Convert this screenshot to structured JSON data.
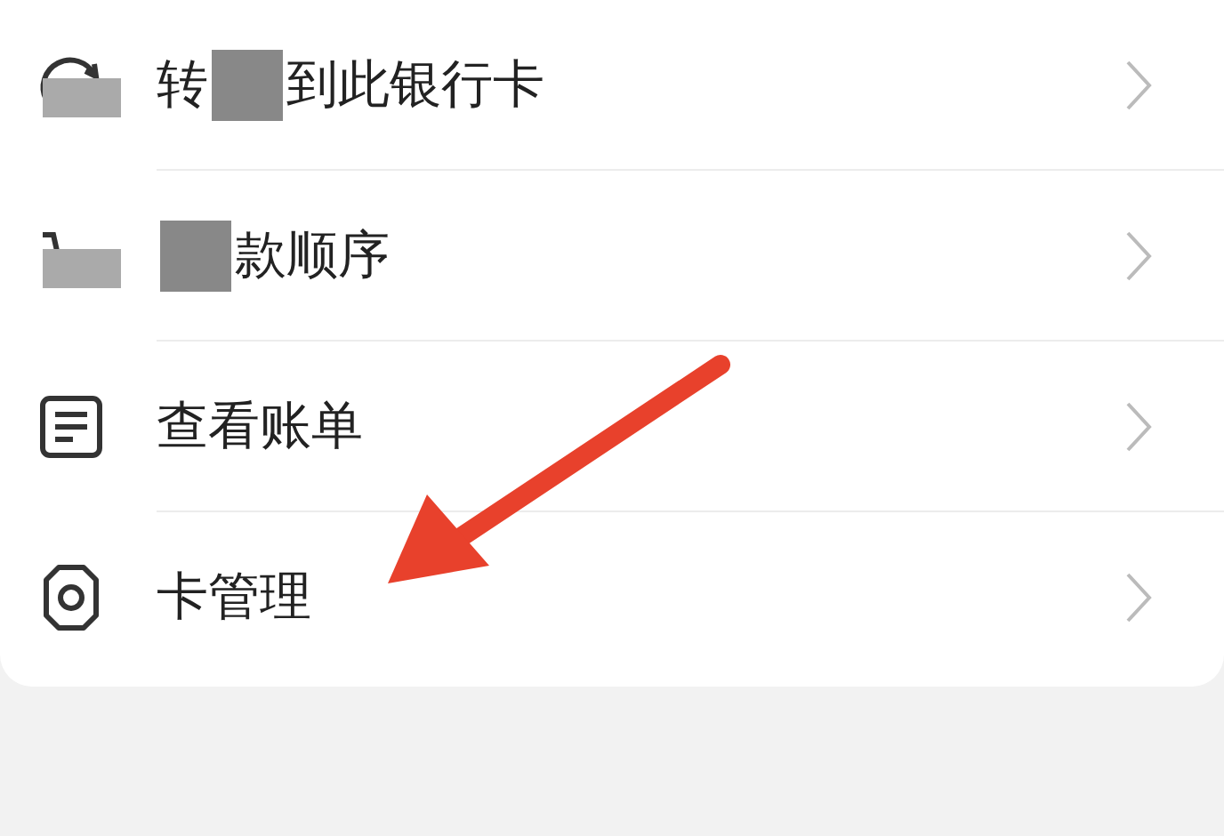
{
  "menu_items": [
    {
      "kind": "transfer",
      "segments": [
        "转",
        "到此银行卡"
      ],
      "censored": true
    },
    {
      "kind": "order",
      "segments": [
        "款顺序"
      ],
      "censored": true
    },
    {
      "kind": "bill",
      "segments": [
        "查看账单"
      ],
      "censored": false
    },
    {
      "kind": "gear",
      "segments": [
        "卡管理"
      ],
      "censored": false
    }
  ]
}
